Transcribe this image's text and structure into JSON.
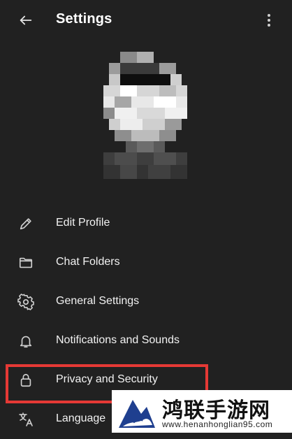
{
  "header": {
    "title": "Settings",
    "back_icon": "arrow-left-icon",
    "more_icon": "more-vertical-icon"
  },
  "menu": {
    "items": [
      {
        "label": "Edit Profile",
        "icon": "pencil-icon"
      },
      {
        "label": "Chat Folders",
        "icon": "folder-icon"
      },
      {
        "label": "General Settings",
        "icon": "gear-icon"
      },
      {
        "label": "Notifications and Sounds",
        "icon": "bell-icon"
      },
      {
        "label": "Privacy and Security",
        "icon": "lock-icon",
        "highlighted": true
      },
      {
        "label": "Language",
        "icon": "translate-icon"
      }
    ]
  },
  "watermark": {
    "title": "鸿联手游网",
    "url": "www.henanhonglian95.com"
  },
  "colors": {
    "background": "#212121",
    "highlight_border": "#e53935",
    "text": "#ffffff"
  }
}
